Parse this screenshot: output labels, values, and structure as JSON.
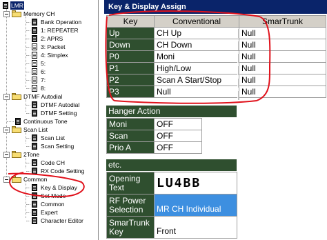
{
  "tree": {
    "root_label": "LMR",
    "groups": [
      {
        "label": "Memory CH",
        "items": [
          "Bank Operation",
          "1: REPEATER",
          "2: APRS",
          "3: Packet",
          "4: Simplex",
          "5:",
          "6:",
          "7:",
          "8:"
        ]
      },
      {
        "label": "DTMF Autodial",
        "items": [
          "DTMF Autodial",
          "DTMF Setting"
        ]
      },
      {
        "label": "Continuous Tone",
        "items": []
      },
      {
        "label": "Scan List",
        "items": [
          "Scan List",
          "Scan Setting"
        ]
      },
      {
        "label": "2Tone",
        "items": [
          "Code CH",
          "RX Code Setting"
        ]
      },
      {
        "label": "Common",
        "items": [
          "Key & Display",
          "Set Mode",
          "Common",
          "Expert",
          "Character Editor"
        ]
      }
    ]
  },
  "panel": {
    "title": "Key & Display Assign",
    "key_table": {
      "headers": [
        "Key",
        "Conventional",
        "SmarTrunk"
      ],
      "rows": [
        {
          "key": "Up",
          "conventional": "CH Up",
          "smartrunk": "Null"
        },
        {
          "key": "Down",
          "conventional": "CH Down",
          "smartrunk": "Null"
        },
        {
          "key": "P0",
          "conventional": "Moni",
          "smartrunk": "Null"
        },
        {
          "key": "P1",
          "conventional": "High/Low",
          "smartrunk": "Null"
        },
        {
          "key": "P2",
          "conventional": "Scan A Start/Stop",
          "smartrunk": "Null"
        },
        {
          "key": "P3",
          "conventional": "Null",
          "smartrunk": "Null"
        }
      ]
    },
    "hanger": {
      "title": "Hanger Action",
      "rows": [
        {
          "key": "Moni",
          "value": "OFF"
        },
        {
          "key": "Scan",
          "value": "OFF"
        },
        {
          "key": "Prio A",
          "value": "OFF"
        }
      ]
    },
    "etc": {
      "title": "etc.",
      "opening_text_label": "Opening Text",
      "opening_text_value": "LU4BB",
      "rf_power_label": "RF Power Selection",
      "rf_power_value": "MR CH Individual",
      "smartrunk_key_label": "SmarTrunk Key",
      "smartrunk_key_value": "Front"
    }
  },
  "colors": {
    "header_blue": "#0a246a",
    "row_header_green": "#2f4f2f",
    "highlight_blue": "#3d8fe0",
    "annotation_red": "#e0121c"
  },
  "icons": [
    "expand-collapse-icon",
    "folder-icon",
    "document-icon"
  ]
}
